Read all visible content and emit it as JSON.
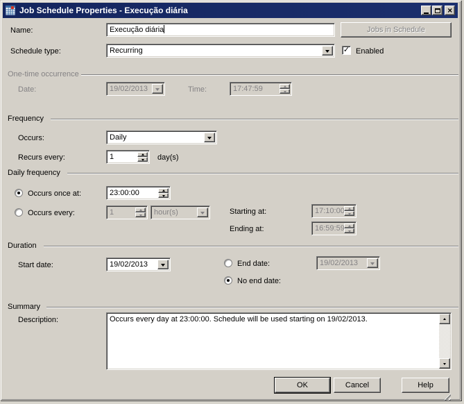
{
  "window": {
    "title": "Job Schedule Properties - Execução diária"
  },
  "icons": {
    "titlebar_icon": "schedule-calendar-icon",
    "close_glyph": "×",
    "check_glyph": "✓"
  },
  "header": {
    "name_label": "Name:",
    "name_value": "Execução diária",
    "jobs_button": "Jobs in Schedule",
    "schedule_type_label": "Schedule type:",
    "schedule_type_value": "Recurring",
    "enabled_label": "Enabled"
  },
  "one_time": {
    "group_label": "One-time occurrence",
    "date_label": "Date:",
    "date_value": "19/02/2013",
    "time_label": "Time:",
    "time_value": "17:47:59"
  },
  "frequency": {
    "group_label": "Frequency",
    "occurs_label": "Occurs:",
    "occurs_value": "Daily",
    "recurs_label": "Recurs every:",
    "recurs_value": "1",
    "recurs_unit": "day(s)"
  },
  "daily_frequency": {
    "group_label": "Daily frequency",
    "once_label": "Occurs once at:",
    "once_value": "23:00:00",
    "every_label": "Occurs every:",
    "every_value": "1",
    "every_unit": "hour(s)",
    "starting_label": "Starting at:",
    "starting_value": "17:10:00",
    "ending_label": "Ending at:",
    "ending_value": "16:59:59"
  },
  "duration": {
    "group_label": "Duration",
    "start_label": "Start date:",
    "start_value": "19/02/2013",
    "end_label": "End date:",
    "end_value": "19/02/2013",
    "no_end_label": "No end date:"
  },
  "summary": {
    "group_label": "Summary",
    "description_label": "Description:",
    "description_value": "Occurs every day at 23:00:00. Schedule will be used starting on 19/02/2013."
  },
  "footer": {
    "ok": "OK",
    "cancel": "Cancel",
    "help": "Help"
  },
  "colors": {
    "titlebar": "#17296a",
    "dialog_bg": "#d4d0c8",
    "disabled_text": "#848284"
  }
}
